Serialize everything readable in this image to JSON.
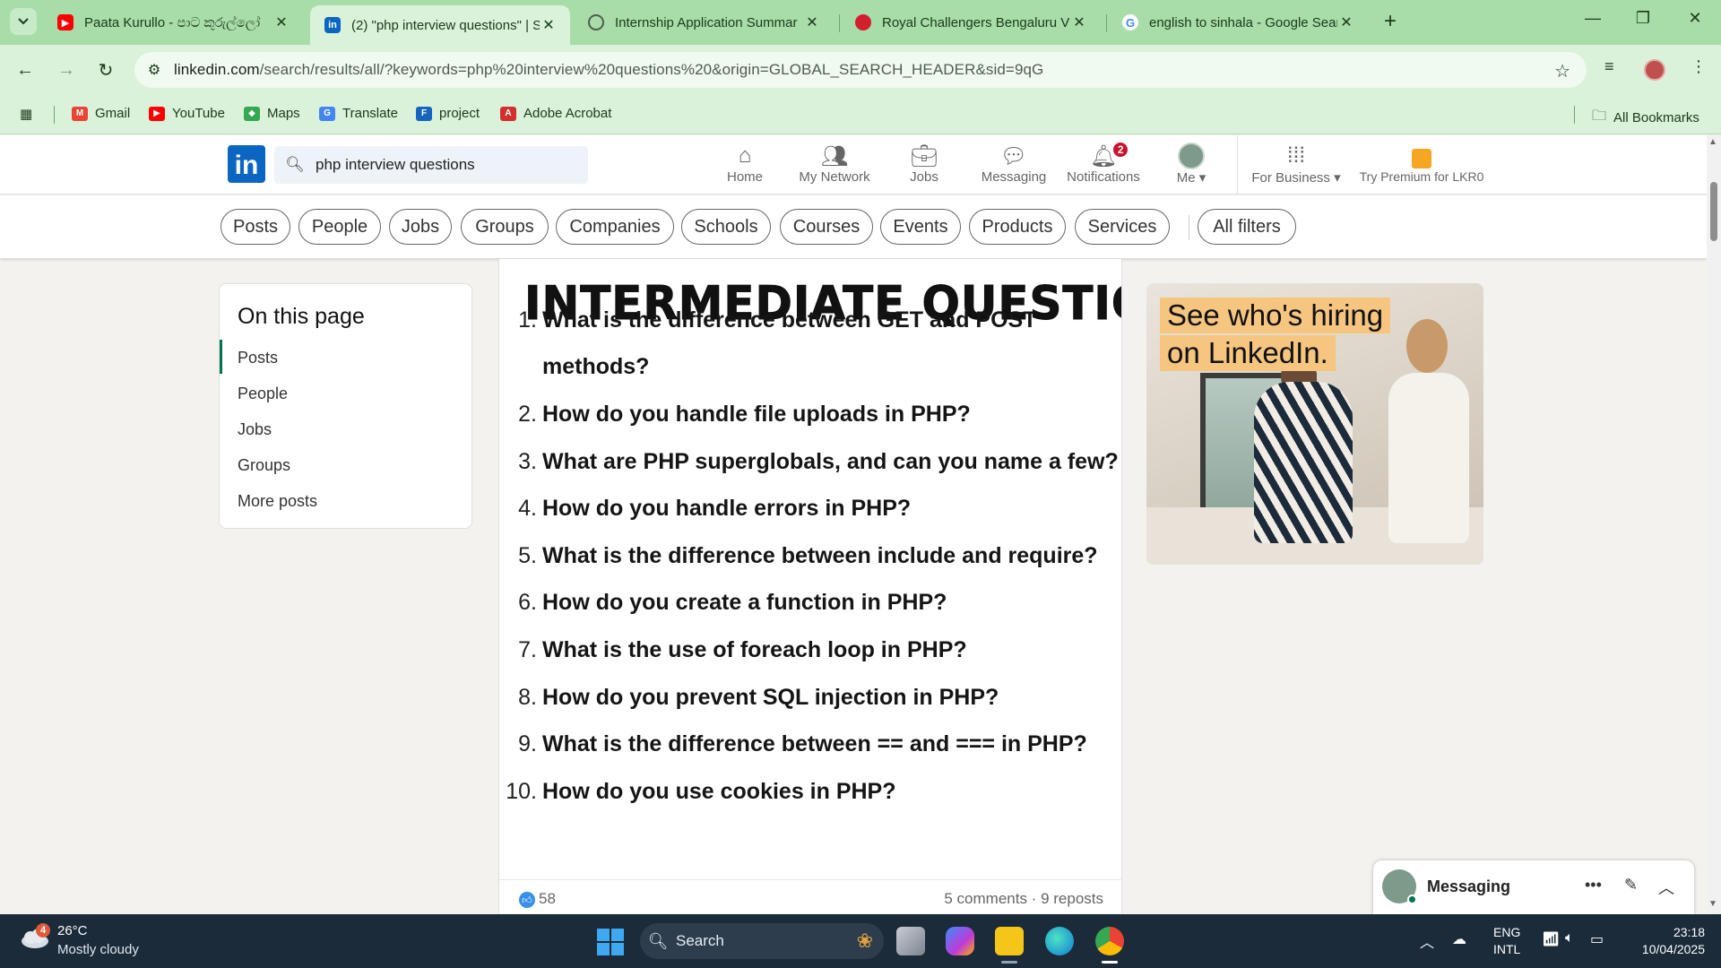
{
  "browser": {
    "tabs": [
      {
        "title": "Paata Kurullo - පාට කුරුල්ලෝ",
        "favicon": "youtube-icon",
        "color": "#ff0000"
      },
      {
        "title": "(2) \"php interview questions\" | S",
        "favicon": "linkedin-icon",
        "color": "#0a66c2",
        "active": true
      },
      {
        "title": "Internship Application Summar",
        "favicon": "globe-icon",
        "color": "#4e5e4e"
      },
      {
        "title": "Royal Challengers Bengaluru VS",
        "favicon": "cricket-icon",
        "color": "#d0202e"
      },
      {
        "title": "english to sinhala - Google Sear",
        "favicon": "google-icon",
        "color": "#4285f4"
      }
    ],
    "url_host": "linkedin.com",
    "url_path": "/search/results/all/?keywords=php%20interview%20questions%20&origin=GLOBAL_SEARCH_HEADER&sid=9qG",
    "bookmarks": [
      {
        "label": "Gmail",
        "icon": "gmail-icon"
      },
      {
        "label": "YouTube",
        "icon": "youtube-icon"
      },
      {
        "label": "Maps",
        "icon": "maps-icon"
      },
      {
        "label": "Translate",
        "icon": "translate-icon"
      },
      {
        "label": "project",
        "icon": "project-icon"
      },
      {
        "label": "Adobe Acrobat",
        "icon": "acrobat-icon"
      }
    ],
    "all_bookmarks": "All Bookmarks"
  },
  "linkedin": {
    "logo_text": "in",
    "search_value": "php interview questions",
    "nav": {
      "home": "Home",
      "network": "My Network",
      "jobs": "Jobs",
      "messaging": "Messaging",
      "notifications": "Notifications",
      "notifications_count": "2",
      "me": "Me",
      "business": "For Business",
      "premium": "Try Premium for LKR0"
    },
    "filters": [
      "Posts",
      "People",
      "Jobs",
      "Groups",
      "Companies",
      "Schools",
      "Courses",
      "Events",
      "Products",
      "Services"
    ],
    "all_filters": "All filters",
    "on_this_page": {
      "title": "On this page",
      "items": [
        "Posts",
        "People",
        "Jobs",
        "Groups",
        "More posts"
      ]
    },
    "post": {
      "title": "INTERMEDIATE QUESTIONS",
      "questions": [
        {
          "n": "1.",
          "line1": "What is the difference between GET and POST",
          "line2": "methods?"
        },
        {
          "n": "2.",
          "line1": "How do you handle file uploads in PHP?"
        },
        {
          "n": "3.",
          "line1": "What are PHP superglobals, and can you name a few?"
        },
        {
          "n": "4.",
          "line1": "How do you handle errors in PHP?"
        },
        {
          "n": "5.",
          "line1": "What is the difference between include and require?"
        },
        {
          "n": "6.",
          "line1": "How do you create a function in PHP?"
        },
        {
          "n": "7.",
          "line1": "What is the use of foreach loop in PHP?"
        },
        {
          "n": "8.",
          "line1": "How do you prevent SQL injection in PHP?"
        },
        {
          "n": "9.",
          "line1": "What is the difference between == and === in PHP?"
        },
        {
          "n": "10.",
          "line1": "How do you use cookies in PHP?"
        }
      ],
      "likes": "58",
      "engagement": "5 comments · 9 reposts"
    },
    "ad": {
      "line1": "See who's hiring",
      "line2": "on LinkedIn."
    },
    "messaging": "Messaging"
  },
  "taskbar": {
    "weather_badge": "4",
    "temperature": "26°C",
    "condition": "Mostly cloudy",
    "search": "Search",
    "lang1": "ENG",
    "lang2": "INTL",
    "time": "23:18",
    "date": "10/04/2025"
  }
}
